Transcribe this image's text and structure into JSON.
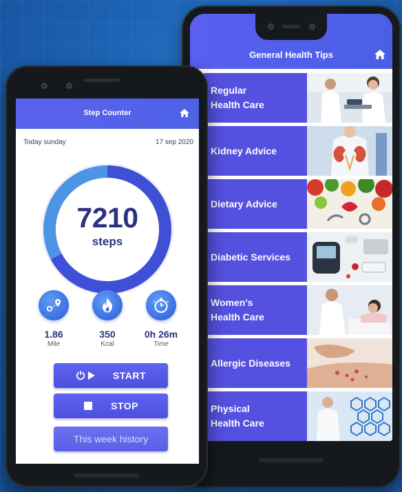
{
  "health_tips_app": {
    "title": "General Health Tips",
    "home_icon": "home-icon",
    "accent_color": "#5551e0",
    "tips": [
      {
        "label": "Regular\nHealth Care",
        "icon": "doctor-patient-photo"
      },
      {
        "label": "Kidney Advice",
        "icon": "kidney-photo"
      },
      {
        "label": "Dietary Advice",
        "icon": "vegetables-photo"
      },
      {
        "label": "Diabetic Services",
        "icon": "glucose-meter-photo"
      },
      {
        "label": "Women's\nHealth Care",
        "icon": "women-doctor-photo"
      },
      {
        "label": "Allergic Diseases",
        "icon": "skin-allergy-photo"
      },
      {
        "label": "Physical\nHealth Care",
        "icon": "medical-icons-photo"
      }
    ]
  },
  "step_counter_app": {
    "title": "Step Counter",
    "home_icon": "home-icon",
    "day_label": "Today sunday",
    "date_label": "17 sep 2020",
    "steps_value": "7210",
    "steps_unit": "steps",
    "stats": [
      {
        "value": "1.86",
        "unit": "Mile",
        "icon": "map-route-icon"
      },
      {
        "value": "350",
        "unit": "Kcal",
        "icon": "flame-icon"
      },
      {
        "value": "0h 26m",
        "unit": "Time",
        "icon": "stopwatch-icon"
      }
    ],
    "start_label": "START",
    "stop_label": "STOP",
    "history_label": "This week history",
    "colors": {
      "header": "#5b61ef",
      "ring": "#4659dd",
      "text": "#2b3380"
    }
  }
}
